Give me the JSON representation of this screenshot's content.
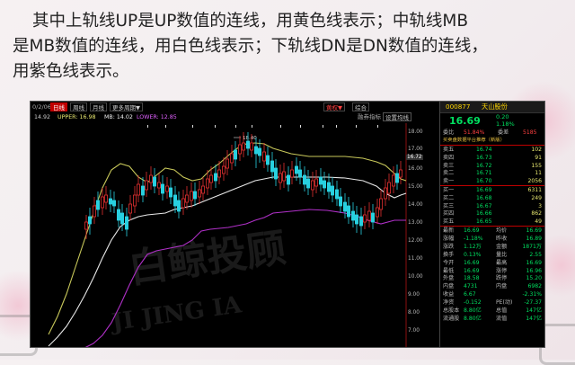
{
  "caption": {
    "line1": "其中上轨线UP是UP数值的连线，用黄色线表示；中轨线MB",
    "line2": "是MB数值的连线，用白色线表示；下轨线DN是DN数值的连线，",
    "line3": "用紫色线表示。"
  },
  "toolbar": {
    "date_partial": "0/2/06",
    "tabs": [
      "日线",
      "周线",
      "月线",
      "更多周期"
    ],
    "active_tab": "日线",
    "more_arrow": "▼",
    "right_items": [
      "黄权",
      "综合"
    ],
    "right_sub": [
      "融券指标",
      "设置均线"
    ]
  },
  "indicator": {
    "prefix": "14.92",
    "up_label": "UPPER: 16.98",
    "mid_label": "MB: 14.02",
    "lower_label": "LOWER: 12.85"
  },
  "chart": {
    "y_ticks": [
      "18.00",
      "17.00",
      "16.72",
      "16.00",
      "15.00",
      "14.00",
      "13.00",
      "12.00",
      "11.00",
      "10.00",
      "9.00",
      "8.00",
      "7.00"
    ],
    "high_mark": "18.40",
    "colors": {
      "up": "#c8c85a",
      "mid": "#e8e8e8",
      "dn": "#b030c8",
      "rise": "#e03030",
      "fall": "#28d0e0",
      "bg": "#000000"
    }
  },
  "quote": {
    "code": "000877",
    "name": "天山股份",
    "price": "16.69",
    "change": "0.20",
    "change_pct": "1.18%",
    "weibi_label": "委比",
    "weibi": "51.84%",
    "weicha_label": "委差",
    "weicha": "5185",
    "hint": "买卖盘数据平台推荐（新版）",
    "sells": [
      {
        "label": "卖五",
        "price": "16.74",
        "vol": "102"
      },
      {
        "label": "卖四",
        "price": "16.73",
        "vol": "91"
      },
      {
        "label": "卖三",
        "price": "16.72",
        "vol": "155"
      },
      {
        "label": "卖二",
        "price": "16.71",
        "vol": "11"
      },
      {
        "label": "卖一",
        "price": "16.70",
        "vol": "2056"
      }
    ],
    "buys": [
      {
        "label": "买一",
        "price": "16.69",
        "vol": "6311"
      },
      {
        "label": "买二",
        "price": "16.68",
        "vol": "249"
      },
      {
        "label": "买三",
        "price": "16.67",
        "vol": "3"
      },
      {
        "label": "买四",
        "price": "16.66",
        "vol": "862"
      },
      {
        "label": "买五",
        "price": "16.65",
        "vol": "49"
      }
    ],
    "stats": [
      {
        "l1": "最新",
        "v1": "16.69",
        "l2": "均价",
        "v2": "16.69"
      },
      {
        "l1": "涨幅",
        "v1": "-1.18%",
        "l2": "昨收",
        "v2": "16.89"
      },
      {
        "l1": "涨跌",
        "v1": "1.12万",
        "l2": "金额",
        "v2": "1871万"
      },
      {
        "l1": "换手",
        "v1": "0.13%",
        "l2": "量比",
        "v2": "2.55"
      },
      {
        "l1": "今开",
        "v1": "16.69",
        "l2": "最高",
        "v2": "16.69"
      },
      {
        "l1": "最低",
        "v1": "16.69",
        "l2": "涨停",
        "v2": "16.96"
      },
      {
        "l1": "外盘",
        "v1": "18.58",
        "l2": "跌停",
        "v2": "15.20"
      },
      {
        "l1": "内盘",
        "v1": "4731",
        "l2": "内盘",
        "v2": "6982"
      },
      {
        "l1": "收益",
        "v1": "6.67",
        "l2": "",
        "v2": "-2.31%"
      },
      {
        "l1": "净资",
        "v1": "-0.152",
        "l2": "PE(动)",
        "v2": "-27.37"
      },
      {
        "l1": "总股本",
        "v1": "8.80亿",
        "l2": "总值",
        "v2": "147亿"
      },
      {
        "l1": "流通股",
        "v1": "8.80亿",
        "l2": "流值",
        "v2": "147亿"
      }
    ]
  },
  "watermark": {
    "cn": "白鲸投顾",
    "en": "JI JING IA"
  }
}
